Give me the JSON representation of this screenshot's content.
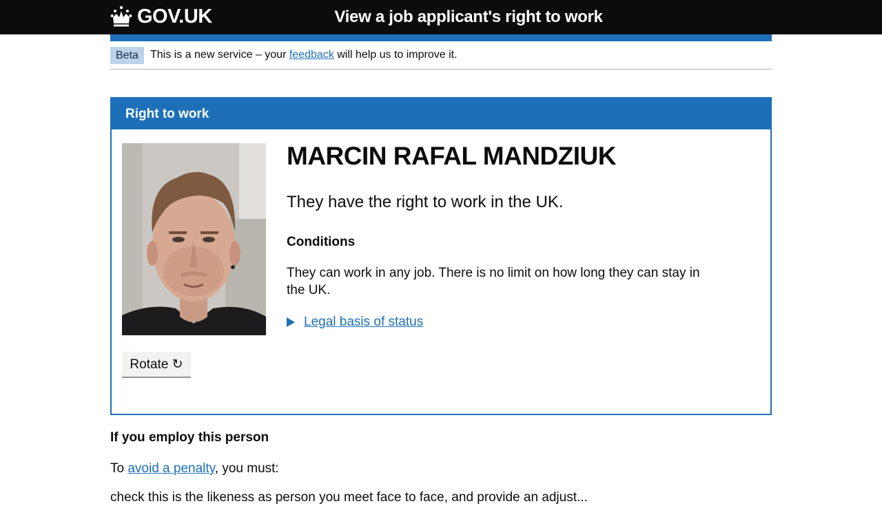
{
  "header": {
    "logo_text": "GOV.UK",
    "service_name": "View a job applicant's right to work"
  },
  "phase_banner": {
    "tag": "Beta",
    "text_before": "This is a new service – your",
    "link": "feedback",
    "text_after": "will help us to improve it."
  },
  "card": {
    "title": "Right to work",
    "person_name": "MARCIN RAFAL MANDZIUK",
    "status": "They have the right to work in the UK.",
    "conditions_heading": "Conditions",
    "conditions_text": "They can work in any job. There is no limit on how long they can stay in the UK.",
    "legal_basis_link": "Legal basis of status",
    "rotate_button": "Rotate ↻"
  },
  "employ": {
    "heading": "If you employ this person",
    "intro_before": "To",
    "intro_link": "avoid a penalty",
    "intro_after": ", you must:",
    "cut_line": "check this is the likeness as person you meet face to face, and provide an adjust..."
  },
  "colors": {
    "header_bg": "#0b0c0c",
    "brand_blue": "#1d70b8",
    "tag_bg": "#bbd4ea",
    "button_bg": "#f3f2f1"
  },
  "icons": {
    "crown": "crown-icon",
    "details_arrow": "triangle-right-icon",
    "rotate": "rotate-clockwise-icon"
  }
}
